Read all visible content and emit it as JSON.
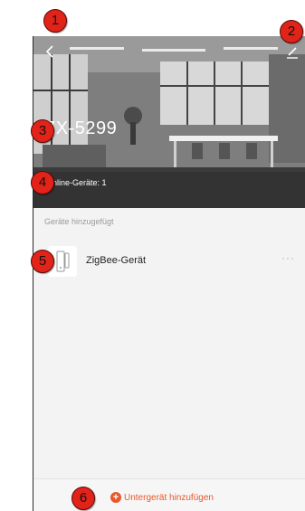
{
  "header": {
    "device_title": "ZX-5299",
    "online_devices": "Online-Geräte: 1",
    "back_icon": "chevron-left-icon",
    "edit_icon": "pencil-icon"
  },
  "devices": {
    "section_label": "Geräte hinzugefügt",
    "items": [
      {
        "name": "ZigBee-Gerät",
        "more": "···"
      }
    ]
  },
  "footer": {
    "add_subdevice_label": "Untergerät hinzufügen",
    "plus_icon": "+"
  },
  "callouts": [
    "1",
    "2",
    "3",
    "4",
    "5",
    "6"
  ],
  "colors": {
    "accent": "#e8582a",
    "callout": "#e2231a"
  }
}
